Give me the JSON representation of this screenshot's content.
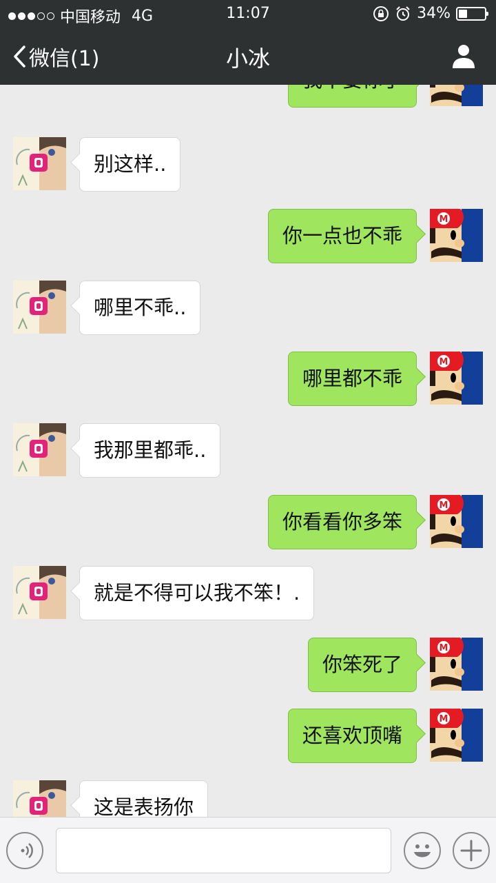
{
  "status_bar": {
    "carrier": "中国移动",
    "network": "4G",
    "time": "11:07",
    "battery": "34%",
    "battery_level": 0.34,
    "signal_bars": 3
  },
  "nav": {
    "back_label": "微信(1)",
    "title": "小冰"
  },
  "messages": [
    {
      "side": "right",
      "text": "我不要你了"
    },
    {
      "side": "left",
      "text": "别这样.."
    },
    {
      "side": "right",
      "text": "你一点也不乖"
    },
    {
      "side": "left",
      "text": "哪里不乖.."
    },
    {
      "side": "right",
      "text": "哪里都不乖"
    },
    {
      "side": "left",
      "text": "我那里都乖.."
    },
    {
      "side": "right",
      "text": "你看看你多笨"
    },
    {
      "side": "left",
      "text": "就是不得可以我不笨！."
    },
    {
      "side": "right",
      "text": "你笨死了"
    },
    {
      "side": "right",
      "text": "还喜欢顶嘴"
    },
    {
      "side": "left",
      "text": "这是表扬你"
    }
  ],
  "input_bar": {
    "voice_icon": "voice-icon",
    "emoji_icon": "emoji-icon",
    "plus_icon": "plus-icon",
    "input_value": ""
  },
  "colors": {
    "bar": "#2e3132",
    "sent_bubble": "#9fe55e",
    "received_bubble": "#ffffff",
    "background": "#ebebeb"
  }
}
